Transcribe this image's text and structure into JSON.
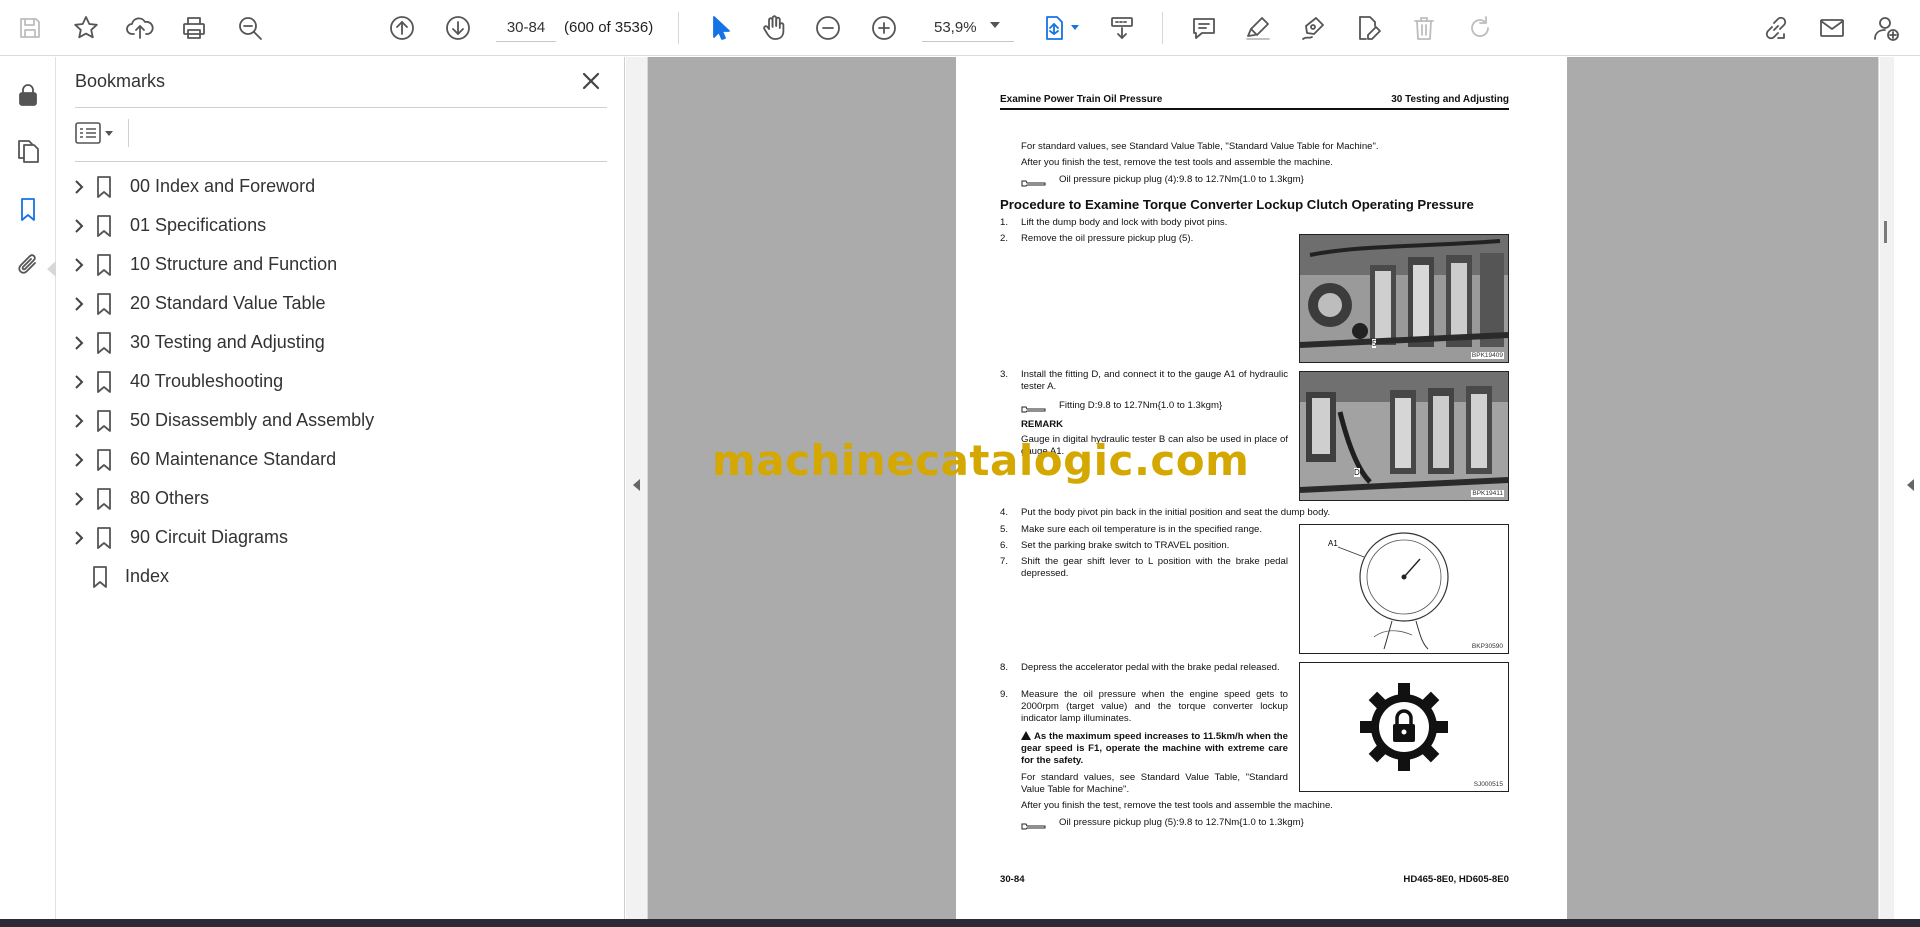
{
  "toolbar": {
    "page_number": "30-84",
    "page_count": "(600 of 3536)",
    "zoom": "53,9%",
    "icons": [
      "save-icon",
      "bookmark-star-icon",
      "upload-icon",
      "print-icon",
      "find-zoom-icon",
      "previous-page-icon",
      "next-page-icon",
      "select-cursor-icon",
      "hand-icon",
      "zoom-out-icon",
      "zoom-in-icon",
      "fit-page-icon",
      "scroll-mode-icon",
      "comment-icon",
      "highlight-icon",
      "sign-icon",
      "edit-pdf-icon",
      "delete-icon",
      "rotate-icon",
      "share-link-icon",
      "email-icon",
      "user-account-icon"
    ]
  },
  "rail": {
    "icons": [
      "lock-icon",
      "pages-icon",
      "bookmarks-icon",
      "attachments-icon"
    ]
  },
  "bookmarks": {
    "title": "Bookmarks",
    "items": [
      {
        "label": "00 Index and Foreword",
        "expandable": true
      },
      {
        "label": "01 Specifications",
        "expandable": true
      },
      {
        "label": "10 Structure and Function",
        "expandable": true
      },
      {
        "label": "20 Standard Value Table",
        "expandable": true
      },
      {
        "label": "30 Testing and Adjusting",
        "expandable": true
      },
      {
        "label": "40 Troubleshooting",
        "expandable": true
      },
      {
        "label": "50 Disassembly and Assembly",
        "expandable": true
      },
      {
        "label": "60 Maintenance Standard",
        "expandable": true
      },
      {
        "label": "80 Others",
        "expandable": true
      },
      {
        "label": "90 Circuit Diagrams",
        "expandable": true
      },
      {
        "label": "Index",
        "expandable": false
      }
    ]
  },
  "pdf_page": {
    "header_left": "Examine Power Train Oil Pressure",
    "header_right": "30 Testing and Adjusting",
    "intro_1": "For standard values, see Standard Value Table, \"Standard Value Table for Machine\".",
    "intro_2": "After you finish the test, remove the test tools and assemble the machine.",
    "intro_torque": "Oil pressure pickup plug (4):9.8 to 12.7Nm{1.0 to 1.3kgm}",
    "heading": "Procedure to Examine Torque Converter Lockup Clutch Operating Pressure",
    "step1_num": "1.",
    "step1": "Lift the dump body and lock with body pivot pins.",
    "step2_num": "2.",
    "step2": "Remove the oil pressure pickup plug (5).",
    "fig1_caption": "BPK19409",
    "fig1_label": "5",
    "step3_num": "3.",
    "step3": "Install the fitting D, and connect it to the gauge A1 of hydraulic tester A.",
    "step3_torque": "Fitting D:9.8 to 12.7Nm{1.0 to 1.3kgm}",
    "remark_title": "REMARK",
    "remark_text": "Gauge in digital hydraulic tester B can also be used in place of gauge A1.",
    "fig2_caption": "BPK19411",
    "fig2_label": "D",
    "step4_num": "4.",
    "step4": "Put the body pivot pin back in the initial position and seat the dump body.",
    "step5_num": "5.",
    "step5": "Make sure each oil temperature is in the specified range.",
    "step6_num": "6.",
    "step6": "Set the parking brake switch to TRAVEL position.",
    "step7_num": "7.",
    "step7": "Shift the gear shift lever to L position with the brake pedal depressed.",
    "fig3_caption": "BKP30590",
    "fig3_label": "A1",
    "step8_num": "8.",
    "step8": "Depress the accelerator pedal with the brake pedal released.",
    "step9_num": "9.",
    "step9": "Measure the oil pressure when the engine speed gets to 2000rpm (target value) and the torque converter lockup indicator lamp illuminates.",
    "warning": "As the maximum speed increases to 11.5km/h when the gear speed is F1, operate the machine with extreme care for the safety.",
    "outro_1": "For standard values, see Standard Value Table, \"Standard Value Table for Machine\".",
    "outro_2": "After you finish the test, remove the test tools and assemble the machine.",
    "outro_torque": "Oil pressure pickup plug (5):9.8 to 12.7Nm{1.0 to 1.3kgm}",
    "fig4_caption": "SJ000515",
    "footer_left": "30-84",
    "footer_right": "HD465-8E0, HD605-8E0"
  },
  "watermark": "machinecatalogic.com"
}
